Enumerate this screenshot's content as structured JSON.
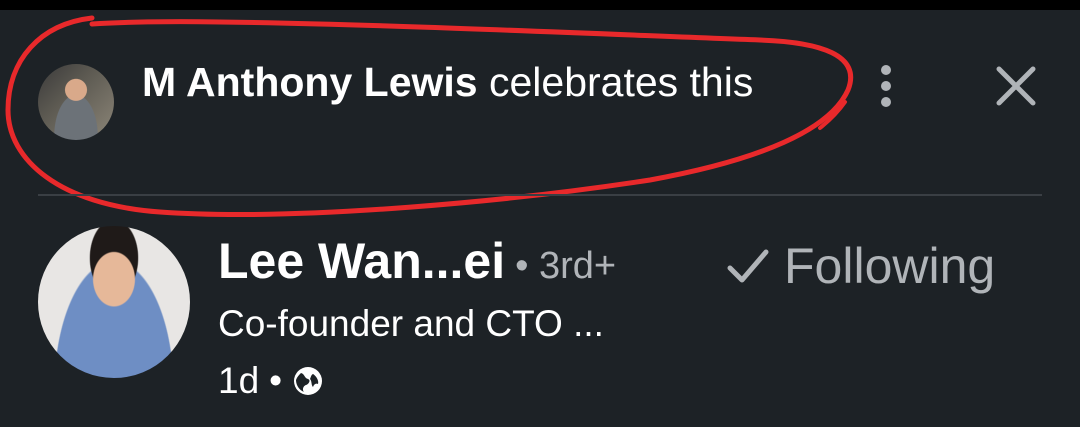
{
  "social_context": {
    "actor_name": "M Anthony Lewis",
    "action_text": " celebrates this"
  },
  "post_author": {
    "name": "Lee Wan...ei",
    "degree": "• 3rd+",
    "headline": "Co-founder and CTO ...",
    "time": "1d",
    "separator": "•"
  },
  "follow": {
    "label": "Following"
  },
  "icons": {
    "more": "more-vertical-icon",
    "close": "close-icon",
    "check": "check-icon",
    "globe": "globe-icon"
  },
  "colors": {
    "background": "#1d2226",
    "text": "#ffffff",
    "secondary_text": "#b0b4b8",
    "annotation": "#e8292b"
  }
}
